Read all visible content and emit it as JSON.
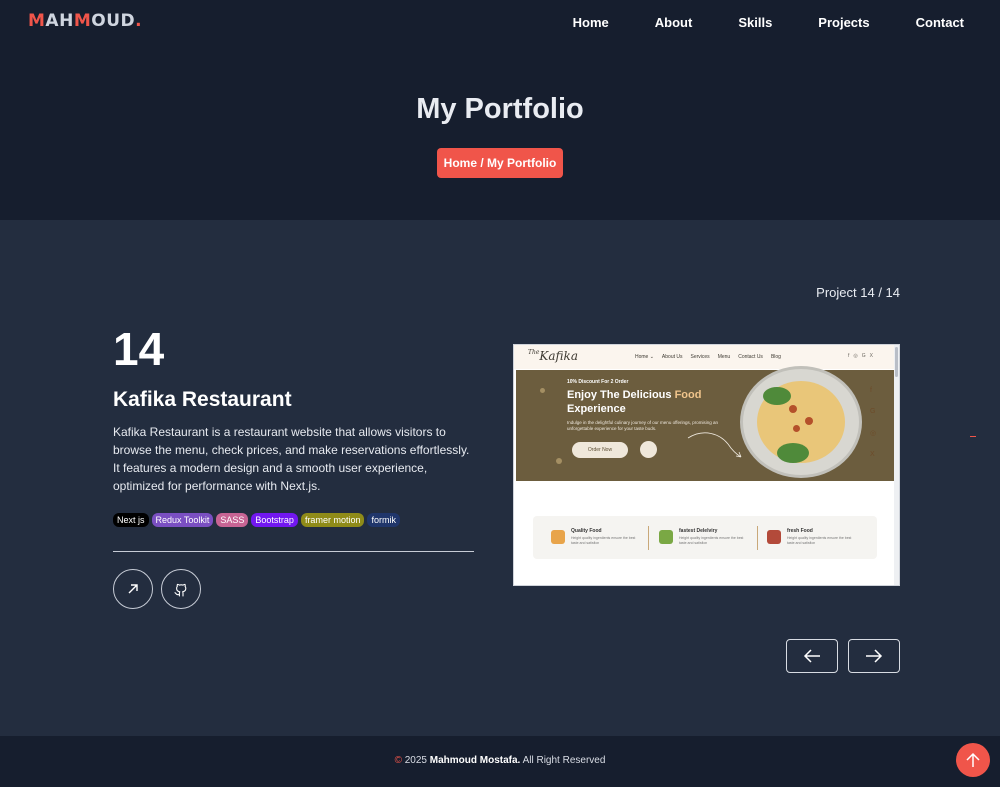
{
  "header": {
    "logo": {
      "part1": "MAH",
      "part2": "MOUD",
      "dot": ".",
      "m1": "M",
      "a": "A",
      "h": "H",
      "m2": "M",
      "oud": "OUD"
    },
    "nav": [
      "Home",
      "About",
      "Skills",
      "Projects",
      "Contact"
    ],
    "title": "My Portfolio",
    "breadcrumb": "Home / My Portfolio"
  },
  "project": {
    "counter": "Project 14 / 14",
    "number": "14",
    "title": "Kafika Restaurant",
    "description": "Kafika Restaurant is a restaurant website that allows visitors to browse the menu, check prices, and make reservations effortlessly. It features a modern design and a smooth user experience, optimized for performance with Next.js.",
    "tags": [
      {
        "label": "Next js",
        "color": "#000000"
      },
      {
        "label": "Redux Toolkit",
        "color": "#7a4fc2"
      },
      {
        "label": "SASS",
        "color": "#c76494"
      },
      {
        "label": "Bootstrap",
        "color": "#7217f0"
      },
      {
        "label": "framer motion",
        "color": "#8f8b18"
      },
      {
        "label": "formik",
        "color": "#20366b"
      }
    ],
    "live_icon": "arrow-up-right-icon",
    "github_icon": "github-icon"
  },
  "preview": {
    "logo_small": "The",
    "logo": "Kafika",
    "nav": [
      "Home ⌄",
      "About Us",
      "Services",
      "Menu",
      "Contact Us",
      "Blog"
    ],
    "social": [
      "f",
      "◎",
      "G",
      "X"
    ],
    "discount": "10% Discount For 2 Order",
    "headline_1": "Enjoy The Delicious ",
    "headline_food": "Food",
    "headline_2": "Experience",
    "subtext": "Indulge in the delightful culinary journey of our menu offerings, promising an unforgettable experience for your taste buds.",
    "order_btn": "Order Now",
    "side_icons": [
      "f",
      "G",
      "◎",
      "X"
    ],
    "features": [
      {
        "title": "Quality Food",
        "desc": "Height quality ingerdients ensure the best taste and satisfion"
      },
      {
        "title": "fastest Delelviry",
        "desc": "Height quality ingerdients ensure the best taste and satisfion"
      },
      {
        "title": "fresh Food",
        "desc": "Height quality ingerdients ensure the best taste and satisfion"
      }
    ]
  },
  "controls": {
    "prev_icon": "arrow-left-icon",
    "next_icon": "arrow-right-icon",
    "top_icon": "arrow-up-icon"
  },
  "footer": {
    "copy": "©",
    "year": "2025",
    "name": "Mahmoud Mostafa.",
    "rights": "All Right Reserved"
  },
  "colors": {
    "accent": "#f0554a",
    "header_bg": "#161e2e",
    "body_bg": "#232d3f"
  }
}
